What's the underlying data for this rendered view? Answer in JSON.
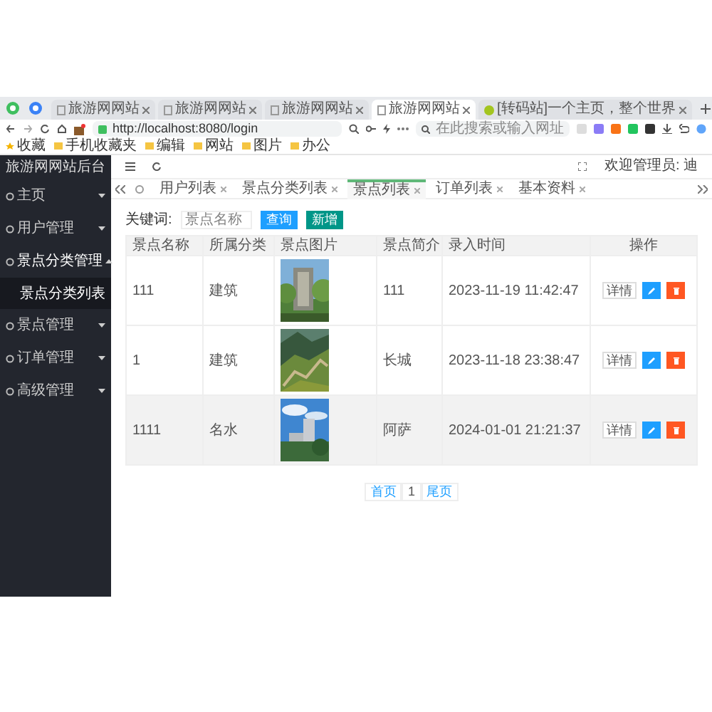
{
  "browser": {
    "tabs": [
      {
        "title": "旅游网网站",
        "selected": false,
        "kind": "page"
      },
      {
        "title": "旅游网网站",
        "selected": false,
        "kind": "page"
      },
      {
        "title": "旅游网网站",
        "selected": false,
        "kind": "page"
      },
      {
        "title": "旅游网网站",
        "selected": true,
        "kind": "page"
      },
      {
        "title": "[转码站]一个主页，整个世界",
        "selected": false,
        "kind": "home"
      }
    ],
    "address": "http://localhost:8080/login",
    "search_placeholder": "在此搜索或输入网址",
    "bookmarks": [
      "收藏",
      "手机收藏夹",
      "编辑",
      "网站",
      "图片",
      "办公"
    ]
  },
  "app": {
    "title": "旅游网网站后台",
    "sidebar": [
      {
        "label": "主页",
        "expanded": false
      },
      {
        "label": "用户管理",
        "expanded": false
      },
      {
        "label": "景点分类管理",
        "expanded": true,
        "children": [
          {
            "label": "景点分类列表",
            "selected": true
          }
        ]
      },
      {
        "label": "景点管理",
        "expanded": false
      },
      {
        "label": "订单管理",
        "expanded": false
      },
      {
        "label": "高级管理",
        "expanded": false
      }
    ],
    "welcome": "欢迎管理员: 迪",
    "tabs": [
      {
        "label": "用户列表",
        "selected": false
      },
      {
        "label": "景点分类列表",
        "selected": false
      },
      {
        "label": "景点列表",
        "selected": true
      },
      {
        "label": "订单列表",
        "selected": false
      },
      {
        "label": "基本资料",
        "selected": false
      }
    ],
    "search": {
      "label": "关键词:",
      "placeholder": "景点名称",
      "buttons": [
        "查询",
        "新增"
      ]
    },
    "table": {
      "columns": [
        "景点名称",
        "所属分类",
        "景点图片",
        "景点简介",
        "录入时间",
        "操作"
      ],
      "rows": [
        {
          "name": "111",
          "category": "建筑",
          "intro": "111",
          "time": "2023-11-19 11:42:47",
          "details": "详情",
          "highlighted": false
        },
        {
          "name": "1",
          "category": "建筑",
          "intro": "长城",
          "time": "2023-11-18 23:38:47",
          "details": "详情",
          "highlighted": false
        },
        {
          "name": "1111",
          "category": "名水",
          "intro": "阿萨",
          "time": "2024-01-01 21:21:37",
          "details": "详情",
          "highlighted": true
        }
      ]
    },
    "pagination": [
      "首页",
      "1",
      "尾页"
    ]
  }
}
